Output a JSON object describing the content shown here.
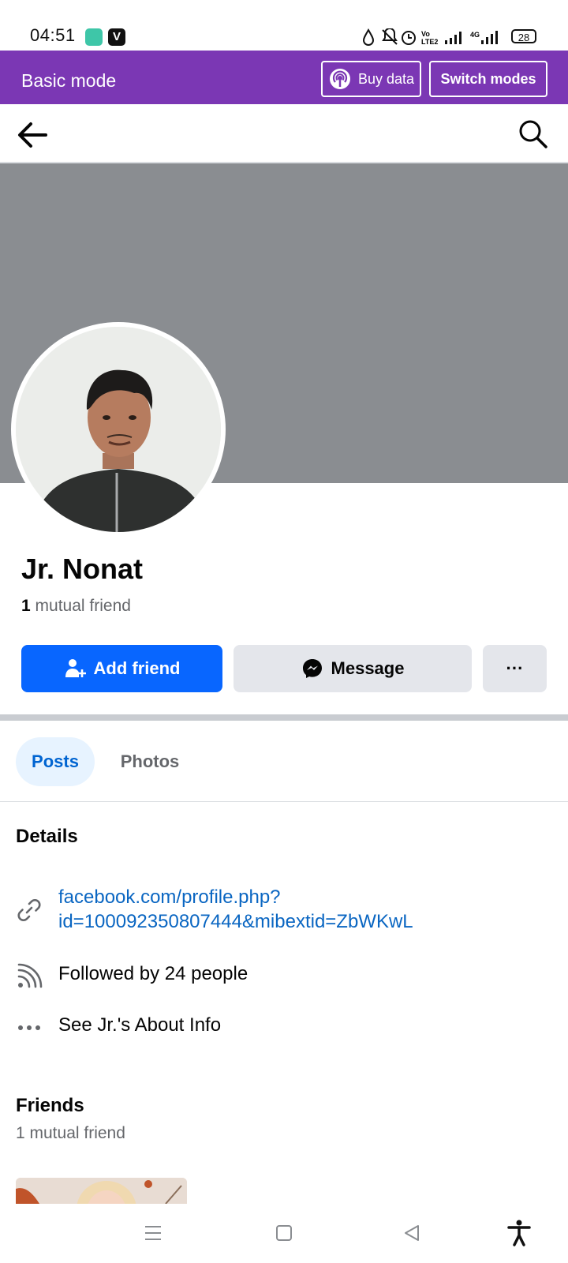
{
  "status_bar": {
    "time": "04:51",
    "indicators": "VoLTE 4G",
    "battery": "28"
  },
  "mode_bar": {
    "title": "Basic mode",
    "buy_data_label": "Buy data",
    "switch_modes_label": "Switch modes",
    "background_color": "#7b37b4"
  },
  "profile": {
    "name": "Jr. Nonat",
    "mutual_count": "1",
    "mutual_label": "mutual friend",
    "add_friend_label": "Add friend",
    "message_label": "Message",
    "more_label": "···"
  },
  "tabs": {
    "posts_label": "Posts",
    "photos_label": "Photos"
  },
  "details": {
    "heading": "Details",
    "link_line1": "facebook.com/profile.php?",
    "link_line2": "id=100092350807444&mibextid=ZbWKwL",
    "followed": "Followed by 24 people",
    "about": "See Jr.'s About Info"
  },
  "friends": {
    "heading": "Friends",
    "subtitle": "1 mutual friend"
  },
  "colors": {
    "primary_button": "#0866ff",
    "link": "#0a66c2",
    "cover": "#8a8d91"
  },
  "icons": [
    "back-arrow-icon",
    "search-icon",
    "add-friend-icon",
    "messenger-icon",
    "link-icon",
    "rss-icon",
    "more-dots-icon",
    "menu-icon",
    "home-square-icon",
    "back-triangle-icon",
    "accessibility-icon"
  ]
}
